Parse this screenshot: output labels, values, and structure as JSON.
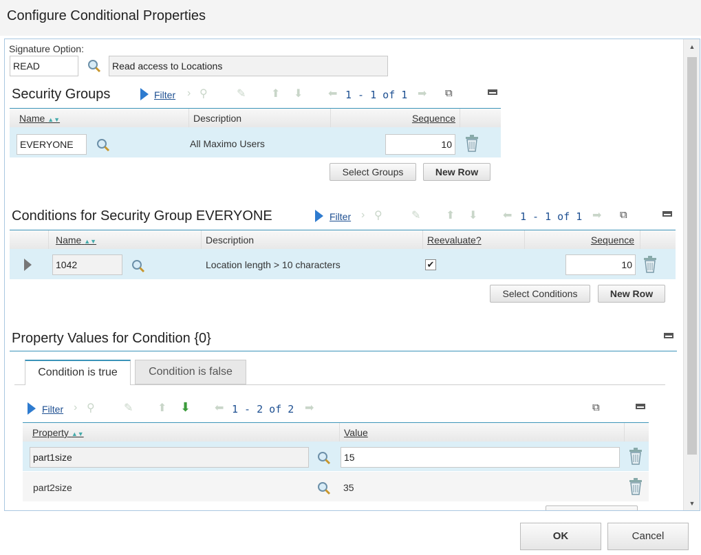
{
  "dialog": {
    "title": "Configure Conditional Properties"
  },
  "signature": {
    "label": "Signature Option:",
    "value": "READ",
    "description": "Read access to Locations"
  },
  "security_groups": {
    "title": "Security Groups",
    "filter_label": "Filter",
    "pager": "1 - 1 of 1",
    "columns": {
      "name": "Name",
      "description": "Description",
      "sequence": "Sequence"
    },
    "rows": [
      {
        "name": "EVERYONE",
        "description": "All Maximo Users",
        "sequence": "10"
      }
    ],
    "select_button": "Select Groups",
    "new_row_button": "New Row"
  },
  "conditions": {
    "title": "Conditions for Security Group EVERYONE",
    "filter_label": "Filter",
    "pager": "1 - 1 of 1",
    "columns": {
      "name": "Name",
      "description": "Description",
      "reevaluate": "Reevaluate?",
      "sequence": "Sequence"
    },
    "rows": [
      {
        "name": "1042",
        "description": "Location length > 10 characters",
        "reevaluate": "✔",
        "sequence": "10"
      }
    ],
    "select_button": "Select Conditions",
    "new_row_button": "New Row"
  },
  "property_values": {
    "title": "Property Values for Condition {0}",
    "tabs": {
      "true_label": "Condition is true",
      "false_label": "Condition is false"
    },
    "filter_label": "Filter",
    "pager": "1 - 2 of 2",
    "columns": {
      "property": "Property",
      "value": "Value"
    },
    "rows": [
      {
        "property": "part1size",
        "value": "15"
      },
      {
        "property": "part2size",
        "value": "35"
      }
    ]
  },
  "footer": {
    "ok_label": "OK",
    "cancel_label": "Cancel"
  },
  "colors": {
    "accent": "#3a93b8",
    "link": "#1d4f91",
    "selected_row": "#dceff7"
  }
}
